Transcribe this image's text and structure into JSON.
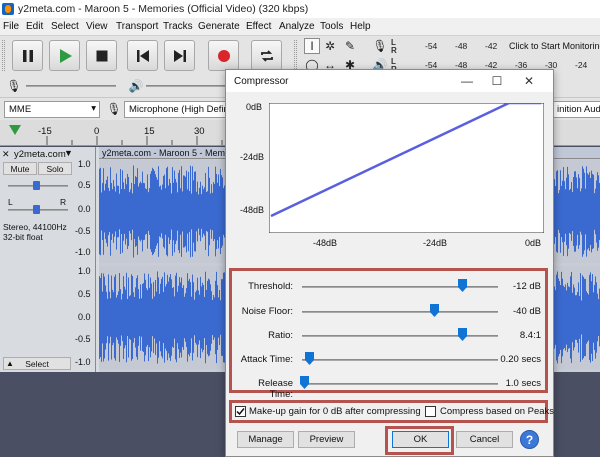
{
  "window": {
    "title": "y2meta.com - Maroon 5 - Memories (Official Video) (320 kbps)"
  },
  "menu": [
    "File",
    "Edit",
    "Select",
    "View",
    "Transport",
    "Tracks",
    "Generate",
    "Effect",
    "Analyze",
    "Tools",
    "Help"
  ],
  "transport": {
    "buttons": [
      "pause-icon",
      "play-icon",
      "stop-icon",
      "skip-to-start-icon",
      "skip-to-end-icon",
      "record-icon",
      "loop-icon"
    ],
    "colors": {
      "play": "#2e9b43",
      "record": "#d9262b"
    }
  },
  "meters": {
    "scale": [
      "-54",
      "-48",
      "-42",
      "-36",
      "-30",
      "-24",
      "-18"
    ],
    "monitor_text": "Click to Start Monitoring",
    "L": "L",
    "R": "R"
  },
  "device": {
    "host": "MME",
    "input": "Microphone (High Defini",
    "output_partial": "inition Audio"
  },
  "ruler": {
    "labels": [
      "-15",
      "0",
      "15",
      "30",
      "45"
    ]
  },
  "track": {
    "name": "y2meta.com",
    "clip_name": "y2meta.com - Maroon 5 - Mem",
    "mute": "Mute",
    "solo": "Solo",
    "L": "L",
    "R": "R",
    "info_line1": "Stereo, 44100Hz",
    "info_line2": "32-bit float",
    "select": "Select",
    "yscale": [
      "1.0",
      "0.5",
      "0.0",
      "-0.5",
      "-1.0",
      "1.0",
      "0.5",
      "0.0",
      "-0.5",
      "-1.0"
    ],
    "waveform_color": "#3a6ad0"
  },
  "compressor": {
    "title": "Compressor",
    "graph": {
      "y_labels": [
        "0dB",
        "-24dB",
        "-48dB"
      ],
      "x_labels": [
        "-48dB",
        "-24dB",
        "0dB"
      ]
    },
    "params": [
      {
        "label": "Threshold:",
        "value": "-12 dB",
        "position": 0.8
      },
      {
        "label": "Noise Floor:",
        "value": "-40 dB",
        "position": 0.63
      },
      {
        "label": "Ratio:",
        "value": "8.4:1",
        "position": 0.81
      },
      {
        "label": "Attack Time:",
        "value": "0.20 secs",
        "position": 0.02
      },
      {
        "label": "Release Time:",
        "value": "1.0 secs",
        "position": 0.0
      }
    ],
    "makeup_gain": {
      "label": "Make-up gain for 0 dB after compressing",
      "checked": true
    },
    "compress_peaks": {
      "label": "Compress based on Peaks",
      "checked": false
    },
    "buttons": {
      "manage": "Manage",
      "preview": "Preview",
      "ok": "OK",
      "cancel": "Cancel",
      "help": "?"
    },
    "highlight_color": "#b5544f"
  }
}
